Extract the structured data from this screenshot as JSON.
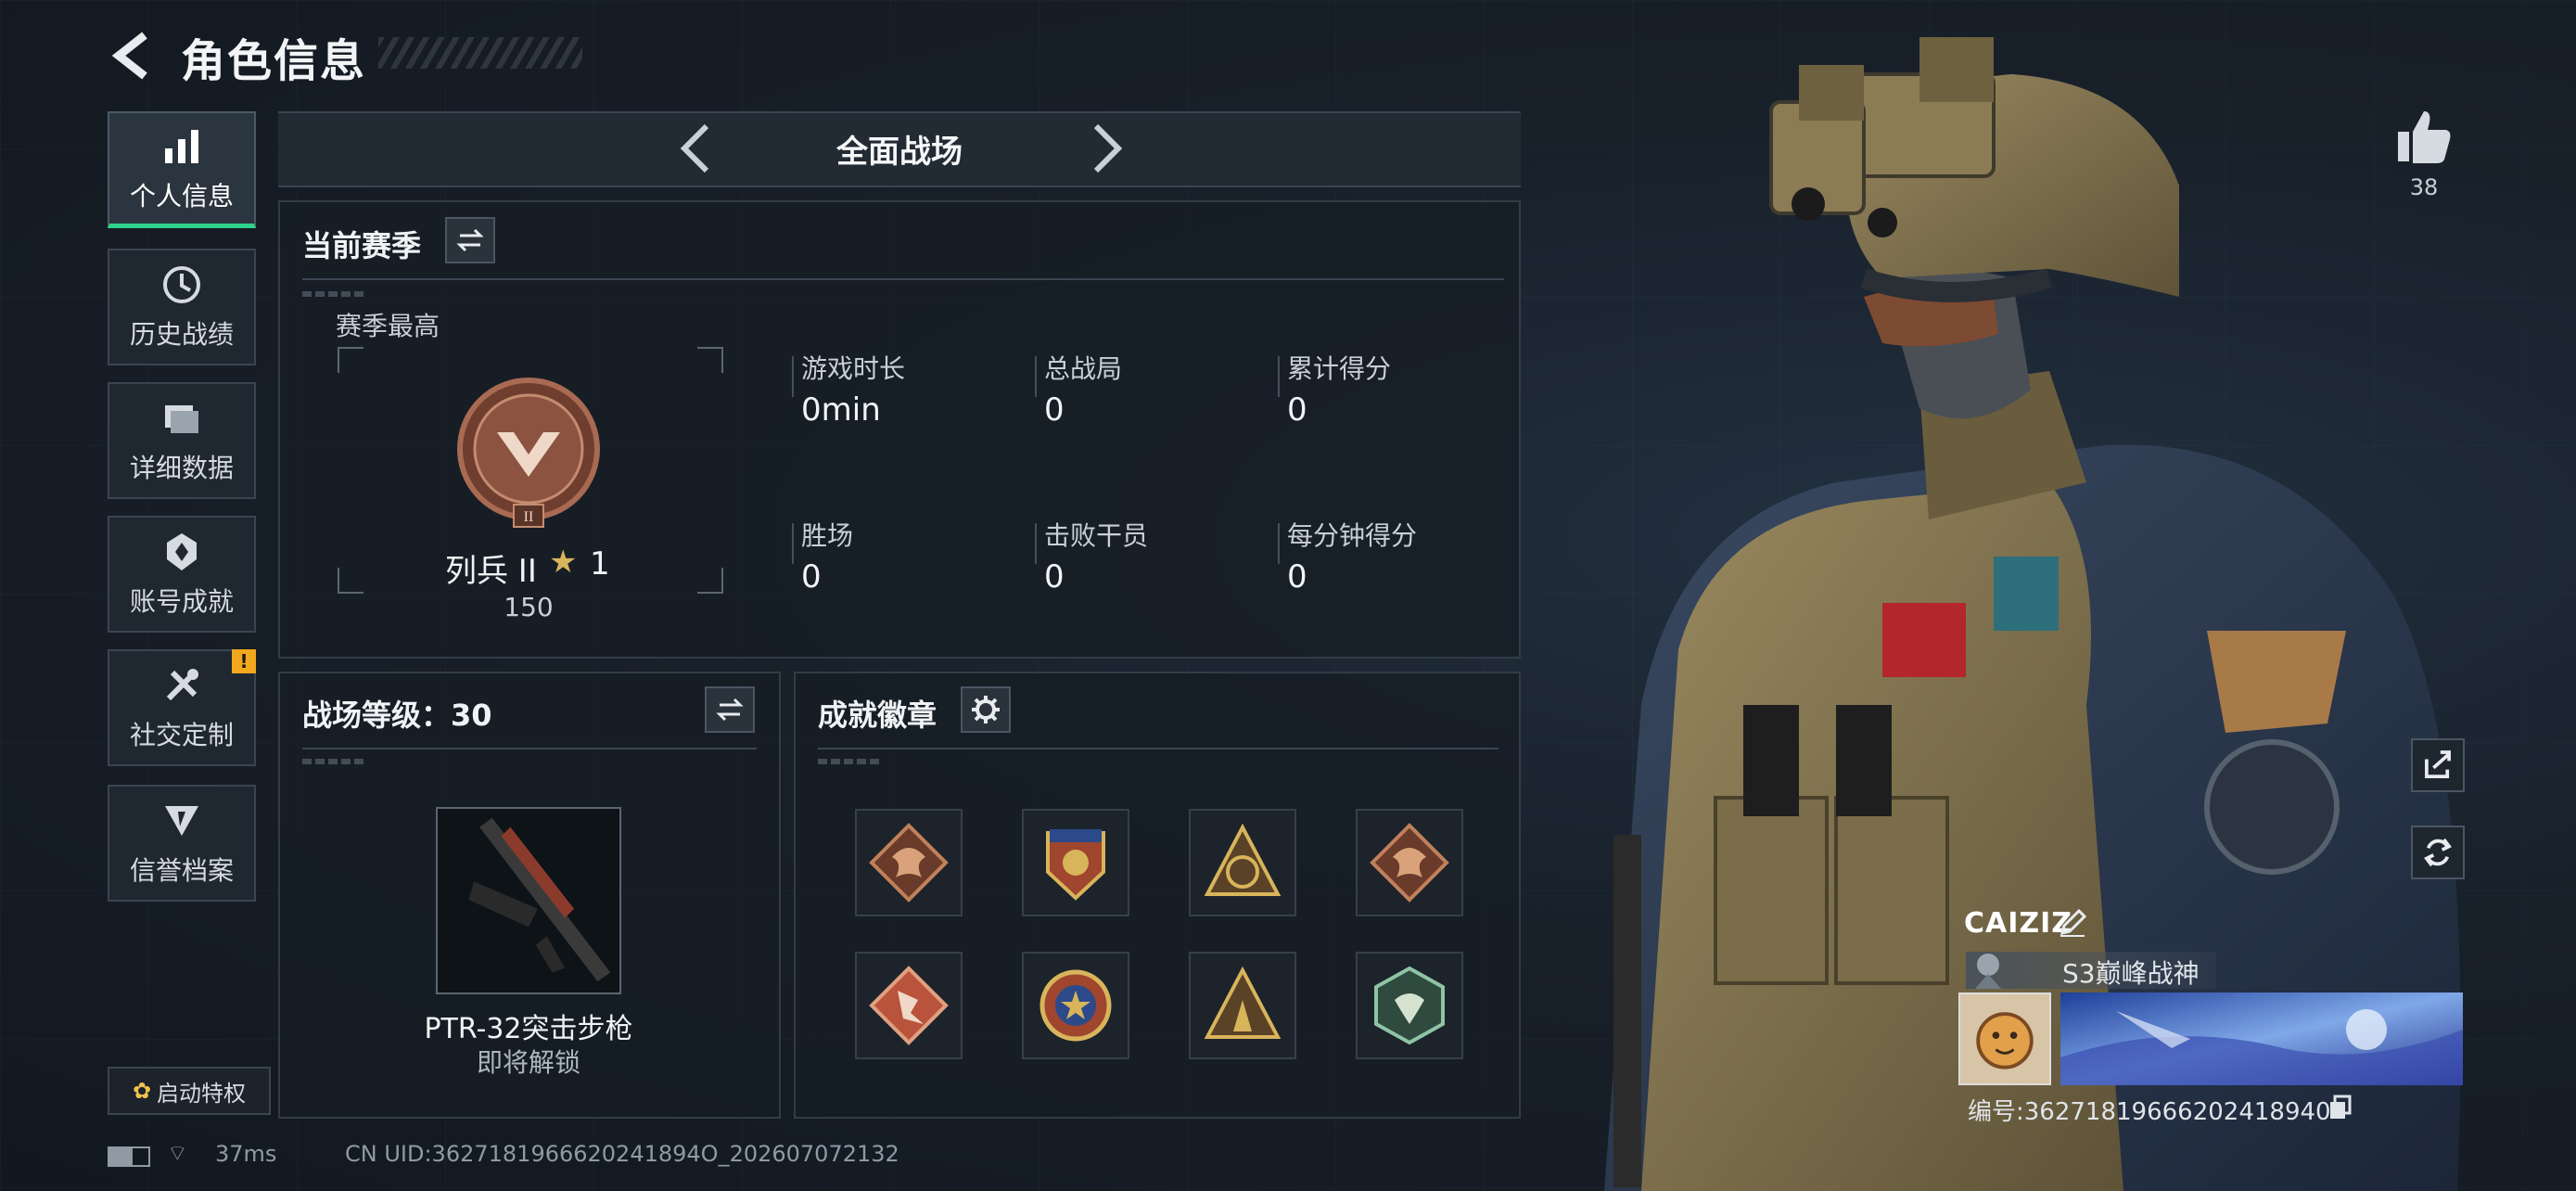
{
  "header": {
    "title": "角色信息"
  },
  "sidebar": {
    "items": [
      {
        "label": "个人信息",
        "icon": "bar-chart-icon",
        "active": true
      },
      {
        "label": "历史战绩",
        "icon": "history-icon"
      },
      {
        "label": "详细数据",
        "icon": "folder-icon"
      },
      {
        "label": "账号成就",
        "icon": "achievement-icon"
      },
      {
        "label": "社交定制",
        "icon": "tools-icon",
        "badge": "!"
      },
      {
        "label": "信誉档案",
        "icon": "credit-icon"
      }
    ],
    "privilege_button": "启动特权"
  },
  "mode_selector": {
    "title": "全面战场"
  },
  "season": {
    "title": "当前赛季",
    "best_label": "赛季最高",
    "rank_name": "列兵 II",
    "rank_roman": "II",
    "stars": "1",
    "points": "150",
    "stats": [
      {
        "label": "游戏时长",
        "value": "0min"
      },
      {
        "label": "总战局",
        "value": "0"
      },
      {
        "label": "累计得分",
        "value": "0"
      },
      {
        "label": "胜场",
        "value": "0"
      },
      {
        "label": "击败干员",
        "value": "0"
      },
      {
        "label": "每分钟得分",
        "value": "0"
      }
    ]
  },
  "battle_level": {
    "title": "战场等级：30",
    "weapon_name": "PTR-32突击步枪",
    "weapon_status": "即将解锁"
  },
  "achievements": {
    "title": "成就徽章",
    "badges": [
      "dragon-badge-icon",
      "eagle-badge-icon",
      "s4-badge-icon",
      "dragon-badge-icon",
      "runner-badge-icon",
      "star-badge-icon",
      "pyramid-badge-icon",
      "hornet-badge-icon"
    ],
    "colors": {
      "bronze": "#b5734a",
      "gold": "#d8b45a",
      "green": "#5f9c7a",
      "red": "#b9533b"
    }
  },
  "status_bar": {
    "ping": "37ms",
    "uid": "CN UID:3627181966620241894O_202607072132"
  },
  "profile": {
    "likes": "38",
    "name": "CAIZIZ",
    "title": "S3巅峰战神",
    "id": "编号:36271819666202418940"
  },
  "colors": {
    "accent": "#2fd48a",
    "warning": "#f2a81d",
    "background": "#18202a"
  }
}
